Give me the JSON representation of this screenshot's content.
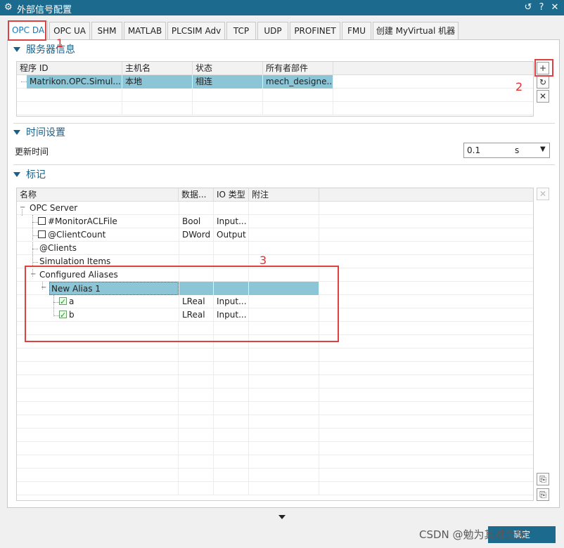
{
  "window": {
    "title": "外部信号配置",
    "buttons": {
      "reset": "↺",
      "help": "?",
      "close": "✕"
    }
  },
  "tabs": [
    {
      "label": "OPC DA",
      "active": true
    },
    {
      "label": "OPC UA"
    },
    {
      "label": "SHM"
    },
    {
      "label": "MATLAB"
    },
    {
      "label": "PLCSIM Adv"
    },
    {
      "label": "TCP"
    },
    {
      "label": "UDP"
    },
    {
      "label": "PROFINET"
    },
    {
      "label": "FMU"
    },
    {
      "label": "创建 MyVirtual 机器"
    }
  ],
  "server_section": {
    "title": "服务器信息",
    "columns": [
      "程序 ID",
      "主机名",
      "状态",
      "所有者部件"
    ],
    "rows": [
      [
        "Matrikon.OPC.Simul...",
        "本地",
        "相连",
        "mech_designe..."
      ]
    ],
    "buttons": {
      "add": "+",
      "refresh": "↻",
      "remove": "✕"
    }
  },
  "time_section": {
    "title": "时间设置",
    "label": "更新时间",
    "value": "0.1",
    "unit": "s"
  },
  "tags_section": {
    "title": "标记",
    "columns": [
      "名称",
      "数据...",
      "IO 类型",
      "附注"
    ],
    "rows": [
      {
        "name": "OPC Server",
        "type": "",
        "io": "",
        "note": ""
      },
      {
        "name": "#MonitorACLFile",
        "type": "Bool",
        "io": "Input...",
        "note": "",
        "checkbox": false
      },
      {
        "name": "@ClientCount",
        "type": "DWord",
        "io": "Output",
        "note": "",
        "checkbox": false
      },
      {
        "name": "@Clients",
        "type": "",
        "io": "",
        "note": ""
      },
      {
        "name": "Simulation Items",
        "type": "",
        "io": "",
        "note": ""
      },
      {
        "name": "Configured Aliases",
        "type": "",
        "io": "",
        "note": ""
      },
      {
        "name": "New Alias 1",
        "type": "",
        "io": "",
        "note": "",
        "selected": true
      },
      {
        "name": "a",
        "type": "LReal",
        "io": "Input...",
        "note": "",
        "checkbox": true
      },
      {
        "name": "b",
        "type": "LReal",
        "io": "Input...",
        "note": "",
        "checkbox": true
      }
    ],
    "side_buttons": {
      "delete": "✕",
      "copy": "⎘",
      "paste": "⎘"
    }
  },
  "annotations": [
    "1",
    "2",
    "3"
  ],
  "footer": {
    "button": "确定",
    "watermark": "CSDN @勉为其难免免"
  }
}
